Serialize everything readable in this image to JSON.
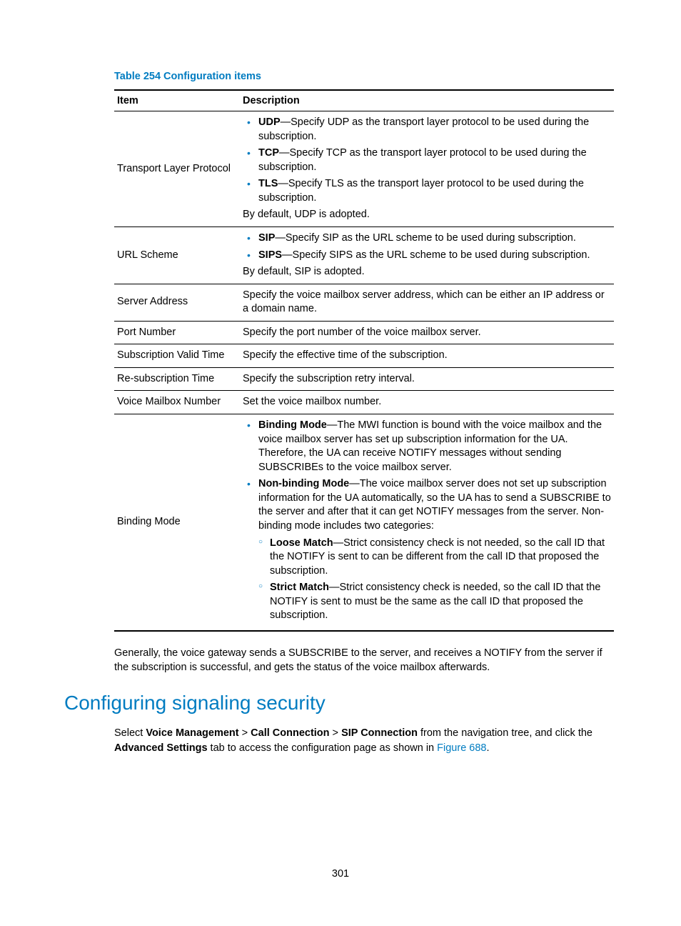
{
  "table": {
    "caption": "Table 254 Configuration items",
    "head": {
      "col1": "Item",
      "col2": "Description"
    },
    "rows": {
      "r1": {
        "item": "Transport Layer Protocol",
        "b1": {
          "term": "UDP",
          "text": "—Specify UDP as the transport layer protocol to be used during the subscription."
        },
        "b2": {
          "term": "TCP",
          "text": "—Specify TCP as the transport layer protocol to be used during the subscription."
        },
        "b3": {
          "term": "TLS",
          "text": "—Specify TLS as the transport layer protocol to be used during the subscription."
        },
        "default": "By default, UDP is adopted."
      },
      "r2": {
        "item": "URL Scheme",
        "b1": {
          "term": "SIP",
          "text": "—Specify SIP as the URL scheme to be used during subscription."
        },
        "b2": {
          "term": "SIPS",
          "text": "—Specify SIPS as the URL scheme to be used during subscription."
        },
        "default": "By default, SIP is adopted."
      },
      "r3": {
        "item": "Server Address",
        "desc": "Specify the voice mailbox server address, which can be either an IP address or a domain name."
      },
      "r4": {
        "item": "Port Number",
        "desc": "Specify the port number of the voice mailbox server."
      },
      "r5": {
        "item": "Subscription Valid Time",
        "desc": "Specify the effective time of the subscription."
      },
      "r6": {
        "item": "Re-subscription Time",
        "desc": "Specify the subscription retry interval."
      },
      "r7": {
        "item": "Voice Mailbox Number",
        "desc": "Set the voice mailbox number."
      },
      "r8": {
        "item": "Binding Mode",
        "b1": {
          "term": "Binding Mode",
          "text": "—The MWI function is bound with the voice mailbox and the voice mailbox server has set up subscription information for the UA. Therefore, the UA can receive NOTIFY messages without sending SUBSCRIBEs to the voice mailbox server."
        },
        "b2": {
          "term": "Non-binding Mode",
          "text": "—The voice mailbox server does not set up subscription information for the UA automatically, so the UA has to send a SUBSCRIBE to the server and after that it can get NOTIFY messages from the server. Non-binding mode includes two categories:"
        },
        "s1": {
          "term": "Loose Match",
          "text": "—Strict consistency check is not needed, so the call ID that the NOTIFY is sent to can be different from the call ID that proposed the subscription."
        },
        "s2": {
          "term": "Strict Match",
          "text": "—Strict consistency check is needed, so the call ID that the NOTIFY is sent to must be the same as the call ID that proposed the subscription."
        }
      }
    }
  },
  "para1": "Generally, the voice gateway sends a SUBSCRIBE to the server, and receives a NOTIFY from the server if the subscription is successful, and gets the status of the voice mailbox afterwards.",
  "section_heading": "Configuring signaling security",
  "para2": {
    "t1": "Select ",
    "b1": "Voice Management",
    "t2": " > ",
    "b2": "Call Connection",
    "t3": " > ",
    "b3": "SIP Connection",
    "t4": " from the navigation tree, and click the ",
    "b4": "Advanced Settings",
    "t5": " tab to access the configuration page as shown in ",
    "link": "Figure 688",
    "t6": "."
  },
  "page_number": "301"
}
